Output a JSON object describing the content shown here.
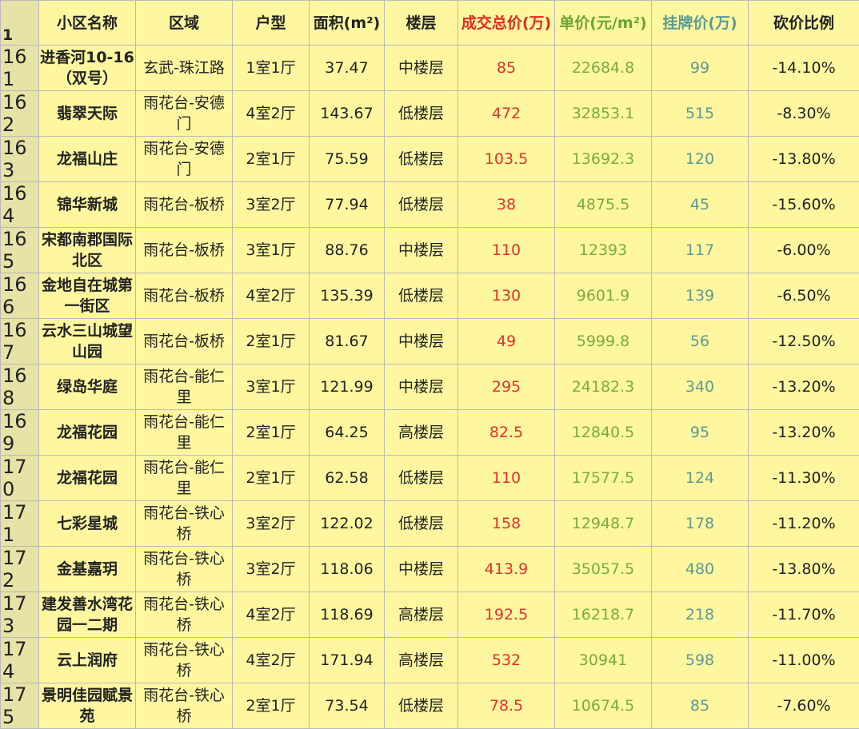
{
  "header": {
    "row_number": "1",
    "columns": [
      "小区名称",
      "区域",
      "户型",
      "面积(m²)",
      "楼层",
      "成交总价(万)",
      "单价(元/m²)",
      "挂牌价(万)",
      "砍价比例"
    ]
  },
  "colors": {
    "cell_background": "#fef7a0",
    "row_number_background": "#e7e2a6",
    "total_price": "#e3312d",
    "unit_price": "#79ab41",
    "list_price": "#5f9993",
    "grid_line": "#b9b9b9"
  },
  "rows": [
    {
      "n": "161",
      "name": "进香河10-16（双号）",
      "area": "玄武-珠江路",
      "layout": "1室1厅",
      "size": "37.47",
      "floor": "中楼层",
      "total": "85",
      "unit": "22684.8",
      "list": "99",
      "cut": "-14.10%"
    },
    {
      "n": "162",
      "name": "翡翠天际",
      "area": "雨花台-安德门",
      "layout": "4室2厅",
      "size": "143.67",
      "floor": "低楼层",
      "total": "472",
      "unit": "32853.1",
      "list": "515",
      "cut": "-8.30%"
    },
    {
      "n": "163",
      "name": "龙福山庄",
      "area": "雨花台-安德门",
      "layout": "2室1厅",
      "size": "75.59",
      "floor": "低楼层",
      "total": "103.5",
      "unit": "13692.3",
      "list": "120",
      "cut": "-13.80%"
    },
    {
      "n": "164",
      "name": "锦华新城",
      "area": "雨花台-板桥",
      "layout": "3室2厅",
      "size": "77.94",
      "floor": "低楼层",
      "total": "38",
      "unit": "4875.5",
      "list": "45",
      "cut": "-15.60%"
    },
    {
      "n": "165",
      "name": "宋都南郡国际北区",
      "area": "雨花台-板桥",
      "layout": "3室1厅",
      "size": "88.76",
      "floor": "中楼层",
      "total": "110",
      "unit": "12393",
      "list": "117",
      "cut": "-6.00%"
    },
    {
      "n": "166",
      "name": "金地自在城第一街区",
      "area": "雨花台-板桥",
      "layout": "4室2厅",
      "size": "135.39",
      "floor": "低楼层",
      "total": "130",
      "unit": "9601.9",
      "list": "139",
      "cut": "-6.50%"
    },
    {
      "n": "167",
      "name": "云水三山城望山园",
      "area": "雨花台-板桥",
      "layout": "2室1厅",
      "size": "81.67",
      "floor": "中楼层",
      "total": "49",
      "unit": "5999.8",
      "list": "56",
      "cut": "-12.50%"
    },
    {
      "n": "168",
      "name": "绿岛华庭",
      "area": "雨花台-能仁里",
      "layout": "3室1厅",
      "size": "121.99",
      "floor": "中楼层",
      "total": "295",
      "unit": "24182.3",
      "list": "340",
      "cut": "-13.20%"
    },
    {
      "n": "169",
      "name": "龙福花园",
      "area": "雨花台-能仁里",
      "layout": "2室1厅",
      "size": "64.25",
      "floor": "高楼层",
      "total": "82.5",
      "unit": "12840.5",
      "list": "95",
      "cut": "-13.20%"
    },
    {
      "n": "170",
      "name": "龙福花园",
      "area": "雨花台-能仁里",
      "layout": "2室1厅",
      "size": "62.58",
      "floor": "低楼层",
      "total": "110",
      "unit": "17577.5",
      "list": "124",
      "cut": "-11.30%"
    },
    {
      "n": "171",
      "name": "七彩星城",
      "area": "雨花台-铁心桥",
      "layout": "3室2厅",
      "size": "122.02",
      "floor": "低楼层",
      "total": "158",
      "unit": "12948.7",
      "list": "178",
      "cut": "-11.20%"
    },
    {
      "n": "172",
      "name": "金基嘉玥",
      "area": "雨花台-铁心桥",
      "layout": "3室2厅",
      "size": "118.06",
      "floor": "中楼层",
      "total": "413.9",
      "unit": "35057.5",
      "list": "480",
      "cut": "-13.80%"
    },
    {
      "n": "173",
      "name": "建发善水湾花园一二期",
      "area": "雨花台-铁心桥",
      "layout": "4室2厅",
      "size": "118.69",
      "floor": "高楼层",
      "total": "192.5",
      "unit": "16218.7",
      "list": "218",
      "cut": "-11.70%"
    },
    {
      "n": "174",
      "name": "云上润府",
      "area": "雨花台-铁心桥",
      "layout": "4室2厅",
      "size": "171.94",
      "floor": "高楼层",
      "total": "532",
      "unit": "30941",
      "list": "598",
      "cut": "-11.00%"
    },
    {
      "n": "175",
      "name": "景明佳园赋景苑",
      "area": "雨花台-铁心桥",
      "layout": "2室1厅",
      "size": "73.54",
      "floor": "低楼层",
      "total": "78.5",
      "unit": "10674.5",
      "list": "85",
      "cut": "-7.60%"
    }
  ]
}
